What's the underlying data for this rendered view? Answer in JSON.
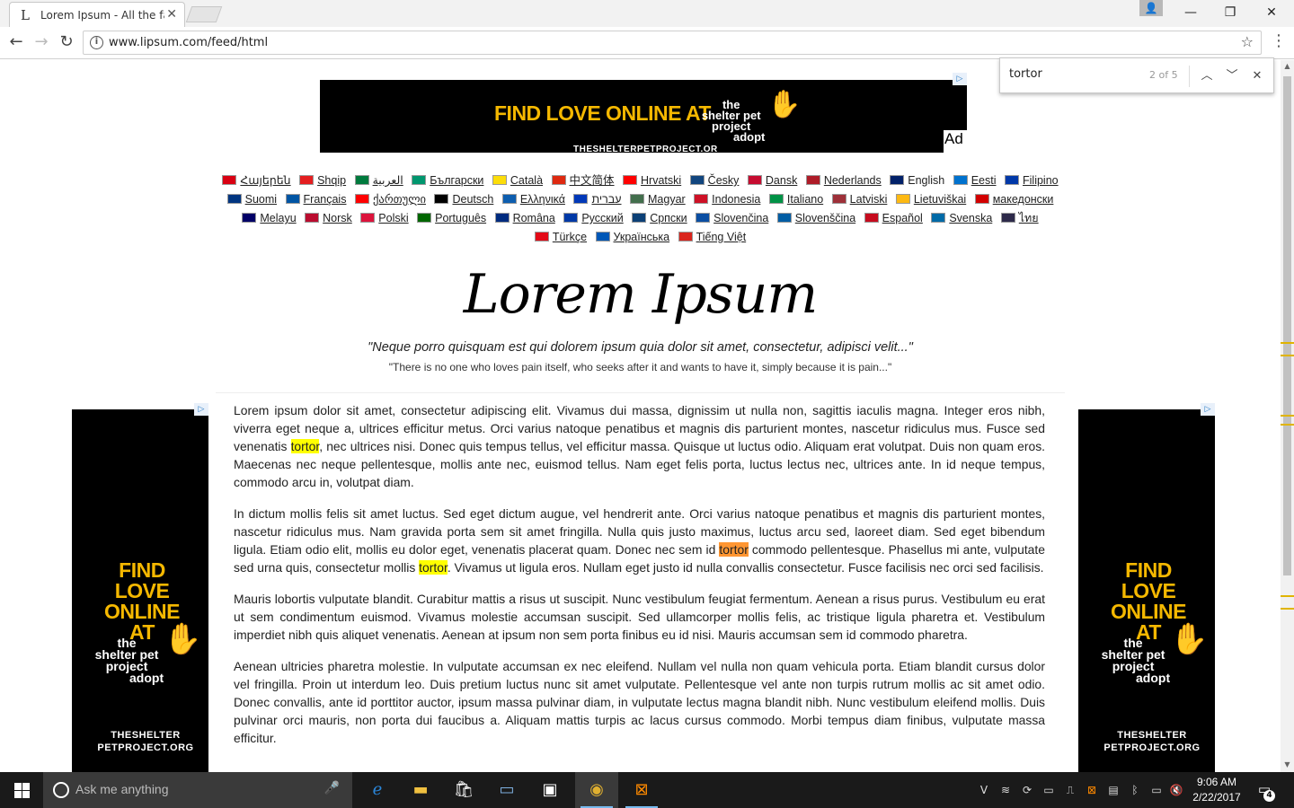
{
  "browser": {
    "tab_title": "Lorem Ipsum - All the facts",
    "tab_favicon": "L",
    "url": "www.lipsum.com/feed/html",
    "find": {
      "query": "tortor",
      "count": "2 of 5"
    }
  },
  "ads": {
    "top_headline": "FIND LOVE ONLINE AT",
    "logo_lines": [
      "the",
      "shelter pet",
      "project",
      "adopt"
    ],
    "top_site": "THESHELTERPETPROJECT.ORG",
    "ad_label": "Ad",
    "side_headline_1": "FIND LOVE",
    "side_headline_2": "ONLINE AT",
    "side_site_1": "THESHELTER",
    "side_site_2": "PETPROJECT.ORG"
  },
  "languages": [
    {
      "name": "Հայերեն",
      "color": "#d90012"
    },
    {
      "name": "Shqip",
      "color": "#e41e20"
    },
    {
      "name": "العربية",
      "color": "#007a3d"
    },
    {
      "name": "Български",
      "color": "#00966e"
    },
    {
      "name": "Català",
      "color": "#fcdd09"
    },
    {
      "name": "中文简体",
      "color": "#de2910"
    },
    {
      "name": "Hrvatski",
      "color": "#ff0000"
    },
    {
      "name": "Česky",
      "color": "#11457e"
    },
    {
      "name": "Dansk",
      "color": "#c60c30"
    },
    {
      "name": "Nederlands",
      "color": "#ae1c28"
    },
    {
      "name": "English",
      "color": "#012169",
      "current": true
    },
    {
      "name": "Eesti",
      "color": "#0072ce"
    },
    {
      "name": "Filipino",
      "color": "#0038a8"
    },
    {
      "name": "Suomi",
      "color": "#003580"
    },
    {
      "name": "Français",
      "color": "#0055a4"
    },
    {
      "name": "ქართული",
      "color": "#ff0000"
    },
    {
      "name": "Deutsch",
      "color": "#000000"
    },
    {
      "name": "Ελληνικά",
      "color": "#0d5eaf"
    },
    {
      "name": "עברית",
      "color": "#0038b8"
    },
    {
      "name": "Magyar",
      "color": "#436f4d"
    },
    {
      "name": "Indonesia",
      "color": "#ce1126"
    },
    {
      "name": "Italiano",
      "color": "#009246"
    },
    {
      "name": "Latviski",
      "color": "#9e3039"
    },
    {
      "name": "Lietuviškai",
      "color": "#fdb913"
    },
    {
      "name": "македонски",
      "color": "#d20000"
    },
    {
      "name": "Melayu",
      "color": "#010066"
    },
    {
      "name": "Norsk",
      "color": "#ba0c2f"
    },
    {
      "name": "Polski",
      "color": "#dc143c"
    },
    {
      "name": "Português",
      "color": "#006600"
    },
    {
      "name": "Româna",
      "color": "#002b7f"
    },
    {
      "name": "Pусский",
      "color": "#0039a6"
    },
    {
      "name": "Српски",
      "color": "#0c4076"
    },
    {
      "name": "Slovenčina",
      "color": "#0b4ea2"
    },
    {
      "name": "Slovenščina",
      "color": "#005da4"
    },
    {
      "name": "Español",
      "color": "#c60b1e"
    },
    {
      "name": "Svenska",
      "color": "#006aa7"
    },
    {
      "name": "ไทย",
      "color": "#2d2a4a"
    },
    {
      "name": "Türkçe",
      "color": "#e30a17"
    },
    {
      "name": "Українська",
      "color": "#0057b7"
    },
    {
      "name": "Tiếng Việt",
      "color": "#da251d"
    }
  ],
  "page": {
    "logo": "Lorem Ipsum",
    "quote_latin": "\"Neque porro quisquam est qui dolorem ipsum quia dolor sit amet, consectetur, adipisci velit...\"",
    "quote_english": "\"There is no one who loves pain itself, who seeks after it and wants to have it, simply because it is pain...\""
  },
  "article": {
    "p1": [
      {
        "t": "Lorem ipsum dolor sit amet, consectetur adipiscing elit. Vivamus dui massa, dignissim ut nulla non, sagittis iaculis magna. Integer eros nibh, viverra eget neque a, ultrices efficitur metus. Orci varius natoque penatibus et magnis dis parturient montes, nascetur ridiculus mus. Fusce sed venenatis "
      },
      {
        "t": "tortor",
        "hl": "match"
      },
      {
        "t": ", nec ultrices nisi. Donec quis tempus tellus, vel efficitur massa. Quisque ut luctus odio. Aliquam erat volutpat. Duis non quam eros. Maecenas nec neque pellentesque, mollis ante nec, euismod tellus. Nam eget felis porta, luctus lectus nec, ultrices ante. In id neque tempus, commodo arcu in, volutpat diam."
      }
    ],
    "p2": [
      {
        "t": "In dictum mollis felis sit amet luctus. Sed eget dictum augue, vel hendrerit ante. Orci varius natoque penatibus et magnis dis parturient montes, nascetur ridiculus mus. Nam gravida porta sem sit amet fringilla. Nulla quis justo maximus, luctus arcu sed, laoreet diam. Sed eget bibendum ligula. Etiam odio elit, mollis eu dolor eget, venenatis placerat quam. Donec nec sem id "
      },
      {
        "t": "tortor",
        "hl": "active"
      },
      {
        "t": " commodo pellentesque. Phasellus mi ante, vulputate sed urna quis, consectetur mollis "
      },
      {
        "t": "tortor",
        "hl": "match"
      },
      {
        "t": ". Vivamus ut ligula eros. Nullam eget justo id nulla convallis consectetur. Fusce facilisis nec orci sed facilisis."
      }
    ],
    "p3": [
      {
        "t": "Mauris lobortis vulputate blandit. Curabitur mattis a risus ut suscipit. Nunc vestibulum feugiat fermentum. Aenean a risus purus. Vestibulum eu erat ut sem condimentum euismod. Vivamus molestie accumsan suscipit. Sed ullamcorper mollis felis, ac tristique ligula pharetra et. Vestibulum imperdiet nibh quis aliquet venenatis. Aenean at ipsum non sem porta finibus eu id nisi. Mauris accumsan sem id commodo pharetra."
      }
    ],
    "p4": [
      {
        "t": "Aenean ultricies pharetra molestie. In vulputate accumsan ex nec eleifend. Nullam vel nulla non quam vehicula porta. Etiam blandit cursus dolor vel fringilla. Proin ut interdum leo. Duis pretium luctus nunc sit amet vulputate. Pellentesque vel ante non turpis rutrum mollis ac sit amet odio. Donec convallis, ante id porttitor auctor, ipsum massa pulvinar diam, in vulputate lectus magna blandit nibh. Nunc vestibulum eleifend mollis. Duis pulvinar orci mauris, non porta dui faucibus a. Aliquam mattis turpis ac lacus cursus commodo. Morbi tempus diam finibus, vulputate massa efficitur."
      }
    ]
  },
  "taskbar": {
    "search_placeholder": "Ask me anything",
    "time": "9:06 AM",
    "date": "2/22/2017",
    "notification_count": "4"
  }
}
